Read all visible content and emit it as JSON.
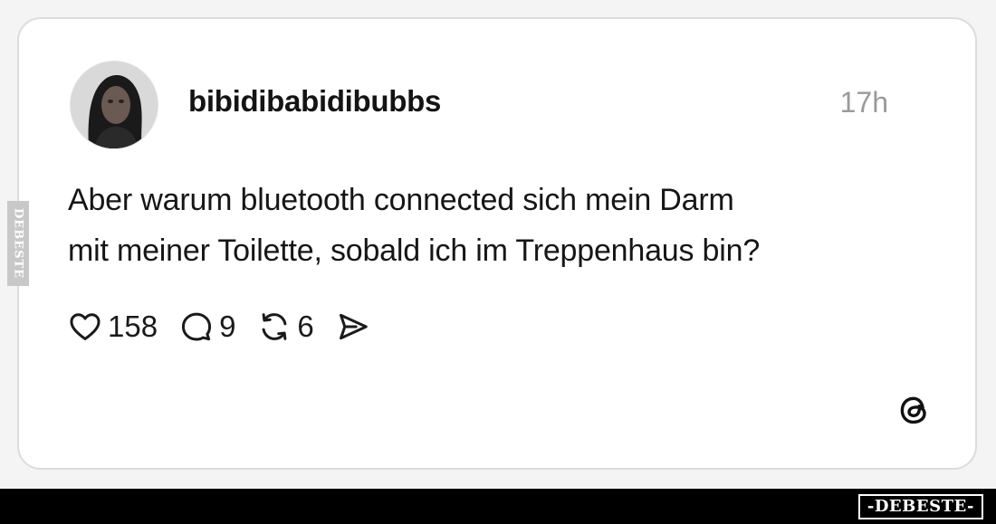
{
  "post": {
    "username": "bibidibabidibubbs",
    "timestamp": "17h",
    "text_lines": [
      "Aber warum bluetooth connected sich mein Darm",
      "mit meiner Toilette, sobald ich im Treppenhaus bin?"
    ]
  },
  "actions": {
    "likes": "158",
    "comments": "9",
    "reposts": "6",
    "icons": [
      "heart-icon",
      "comment-icon",
      "repost-icon",
      "share-icon"
    ]
  },
  "branding": {
    "platform_icon": "threads-logo-icon",
    "side_watermark": "DEBESTE",
    "footer_logo": "-DEBESTE-"
  },
  "colors": {
    "card_background": "#ffffff",
    "card_border": "#dcdcdc",
    "text": "#161616",
    "muted": "#9a9a9a",
    "footer_bar": "#000000"
  }
}
